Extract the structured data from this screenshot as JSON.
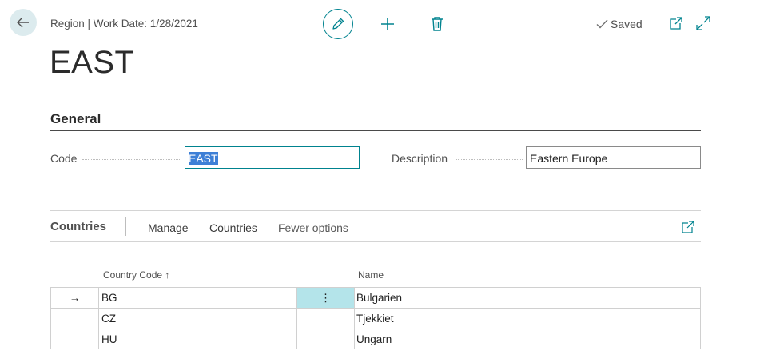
{
  "header": {
    "breadcrumb": "Region | Work Date: 1/28/2021",
    "saved_label": "Saved",
    "icons": {
      "back": "arrow-left-icon",
      "edit": "pencil-icon",
      "new": "plus-icon",
      "delete": "trash-icon",
      "saved": "checkmark-icon",
      "open_new_window": "open-in-new-window-icon",
      "expand": "expand-icon"
    }
  },
  "page": {
    "title": "EAST"
  },
  "general": {
    "section_title": "General",
    "code": {
      "label": "Code",
      "value": "EAST"
    },
    "description": {
      "label": "Description",
      "value": "Eastern Europe"
    }
  },
  "subpage": {
    "title": "Countries",
    "actions": [
      "Manage",
      "Countries",
      "Fewer options"
    ],
    "columns": {
      "code": "Country Code",
      "code_sort_indicator": "↑",
      "name": "Name"
    },
    "rows": [
      {
        "code": "BG",
        "name": "Bulgarien",
        "selected": true
      },
      {
        "code": "CZ",
        "name": "Tjekkiet",
        "selected": false
      },
      {
        "code": "HU",
        "name": "Ungarn",
        "selected": false
      }
    ],
    "row_menu_glyph": "⋮",
    "current_row_glyph": "→"
  },
  "colors": {
    "accent": "#00838f",
    "back_button_bg": "#dcebee",
    "selected_cell": "#b4e4ea",
    "text_selection": "#3d7fd6"
  }
}
